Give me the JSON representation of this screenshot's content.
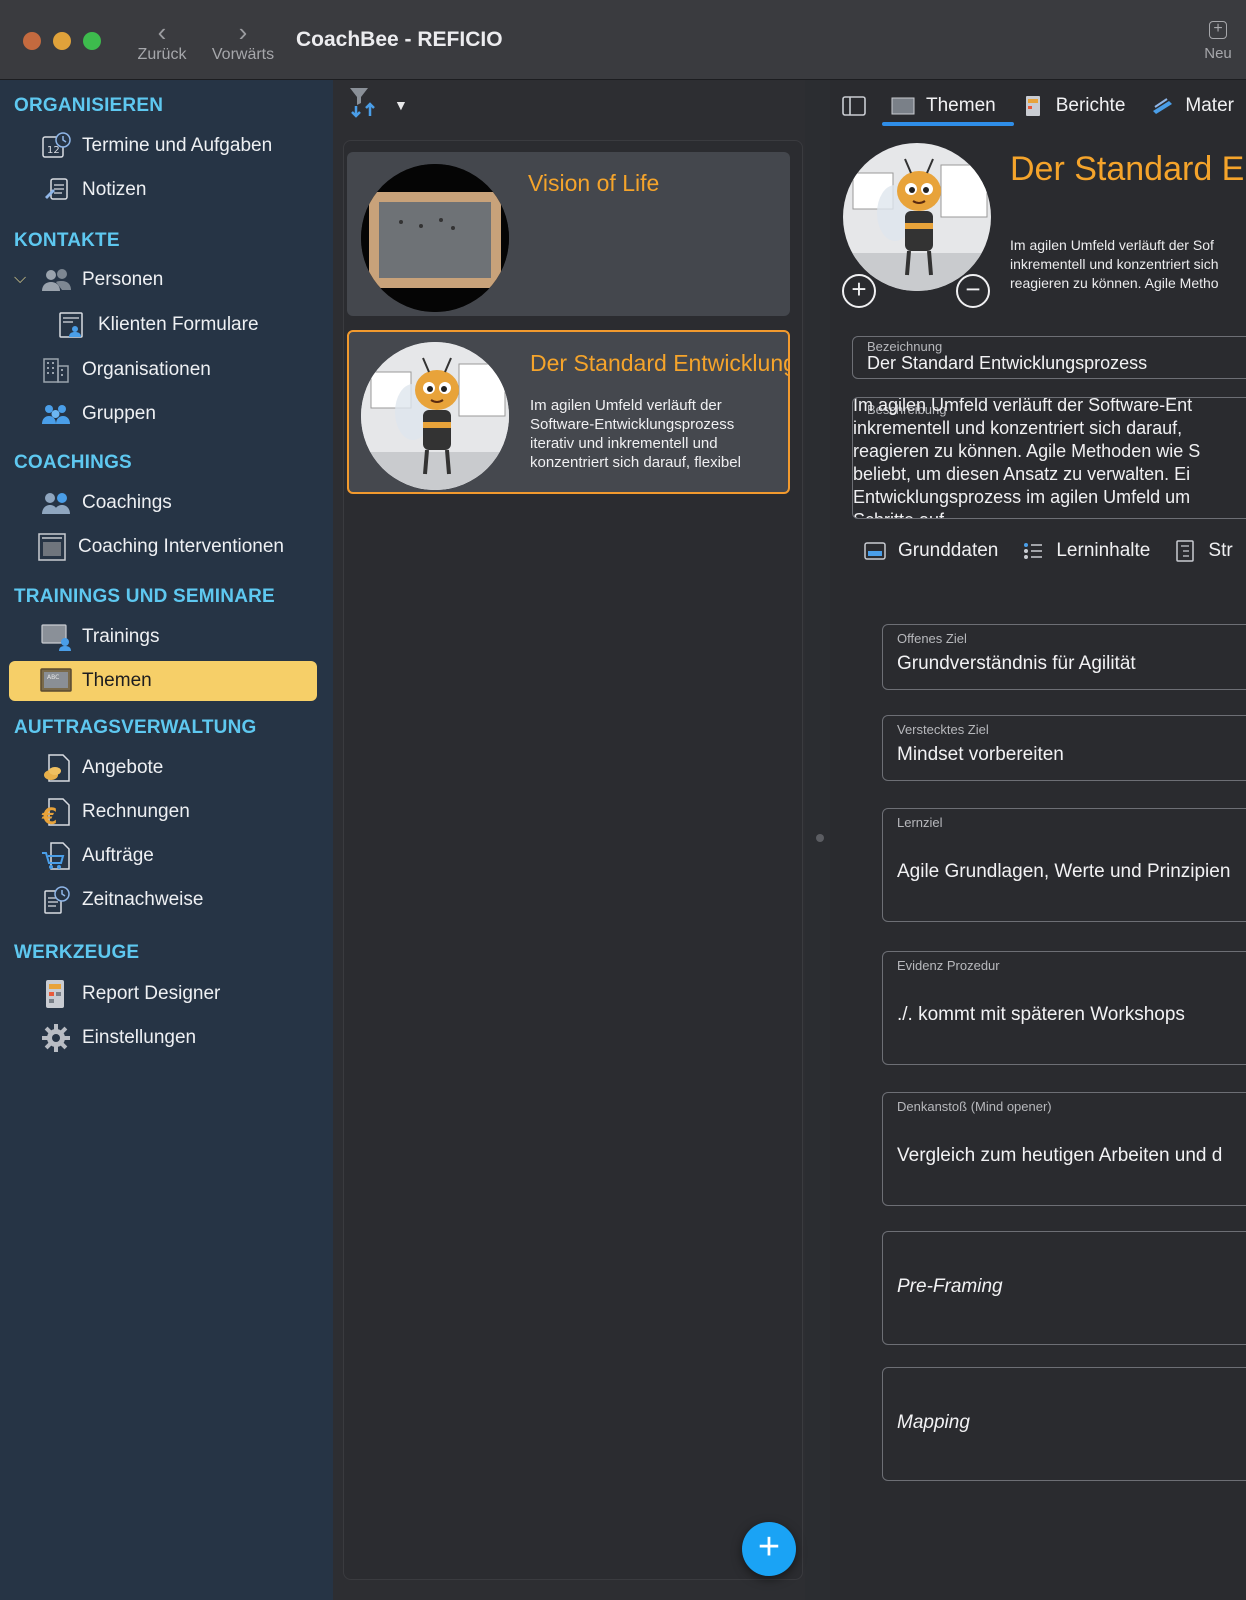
{
  "window": {
    "title": "CoachBee - REFICIO",
    "back_label": "Zurück",
    "forward_label": "Vorwärts",
    "new_label": "Neu"
  },
  "sidebar": {
    "sections": {
      "organisieren": "ORGANISIEREN",
      "kontakte": "KONTAKTE",
      "coachings": "COACHINGS",
      "trainings": "TRAININGS UND SEMINARE",
      "auftrag": "AUFTRAGSVERWALTUNG",
      "werkzeuge": "WERKZEUGE"
    },
    "items": {
      "termine": "Termine und Aufgaben",
      "notizen": "Notizen",
      "personen": "Personen",
      "klienten_formulare": "Klienten Formulare",
      "organisationen": "Organisationen",
      "gruppen": "Gruppen",
      "coachings": "Coachings",
      "coaching_interventionen": "Coaching Interventionen",
      "trainings": "Trainings",
      "themen": "Themen",
      "angebote": "Angebote",
      "rechnungen": "Rechnungen",
      "auftraege": "Aufträge",
      "zeitnachweise": "Zeitnachweise",
      "report_designer": "Report Designer",
      "einstellungen": "Einstellungen"
    },
    "active_item": "themen"
  },
  "list": {
    "cards": [
      {
        "title": "Vision of Life",
        "description": ""
      },
      {
        "title": "Der Standard Entwicklungsprozess",
        "description": "Im agilen Umfeld verläuft der Software-Entwicklungsprozess iterativ und inkrementell und konzentriert sich darauf, flexibel"
      }
    ],
    "add_icon": "plus-icon"
  },
  "detail": {
    "tabs": [
      "Themen",
      "Berichte",
      "Mater"
    ],
    "active_tab": "Themen",
    "title": "Der Standard En",
    "header_desc": "Im agilen Umfeld verläuft der Sof\ninkrementell und konzentriert sich\nreagieren zu können. Agile Metho",
    "bezeichnung_label": "Bezeichnung",
    "bezeichnung_value": "Der Standard Entwicklungsprozess",
    "beschreibung_label": "Beschreibung",
    "beschreibung_value": "Im agilen Umfeld verläuft der Software-Ent\ninkrementell und konzentriert sich darauf, \nreagieren zu können. Agile Methoden wie S\nbeliebt, um diesen Ansatz zu verwalten. Ei\nEntwicklungsprozess im agilen Umfeld um\nSchritte auf",
    "subtabs": [
      "Grunddaten",
      "Lerninhalte",
      "Str"
    ],
    "fields": [
      {
        "label": "Offenes Ziel",
        "value": "Grundverständnis für Agilität"
      },
      {
        "label": "Verstecktes Ziel",
        "value": "Mindset vorbereiten"
      },
      {
        "label": "Lernziel",
        "value": "Agile Grundlagen, Werte und Prinzipien"
      },
      {
        "label": "Evidenz Prozedur",
        "value": "./. kommt mit späteren Workshops"
      },
      {
        "label": "Denkanstoß (Mind opener)",
        "value": "Vergleich zum heutigen Arbeiten und d"
      },
      {
        "label": "",
        "value": "Pre-Framing"
      },
      {
        "label": "",
        "value": "Mapping"
      }
    ]
  },
  "colors": {
    "sidebar_bg": "#263445",
    "section_head": "#5ec8f0",
    "active_item": "#f6cf68",
    "accent_orange": "#f5a42b",
    "tab_underline": "#2f8ee8",
    "fab": "#1aa3f5"
  }
}
